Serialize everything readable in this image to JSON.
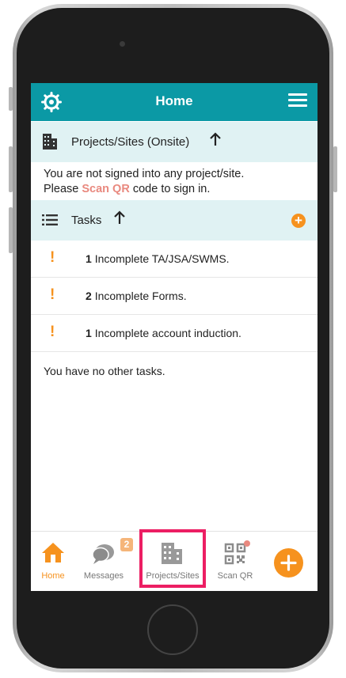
{
  "header": {
    "title": "Home"
  },
  "projects_section": {
    "title": "Projects/Sites (Onsite)",
    "message_part1": "You are not signed into any project/site.",
    "message_part2": "Please",
    "scan_link": "Scan QR",
    "message_part3": "code to sign in."
  },
  "tasks_section": {
    "title": "Tasks",
    "items": [
      {
        "count": "1",
        "text": "Incomplete TA/JSA/SWMS."
      },
      {
        "count": "2",
        "text": "Incomplete Forms."
      },
      {
        "count": "1",
        "text": "Incomplete account induction."
      }
    ],
    "footer": "You have no other tasks."
  },
  "tabbar": {
    "home": "Home",
    "messages": "Messages",
    "messages_badge": "2",
    "projects": "Projects/Sites",
    "scan": "Scan QR"
  },
  "colors": {
    "header": "#0b99a5",
    "accent": "#f6921e",
    "section_bg": "#e0f2f3",
    "highlight": "#ec1e63"
  }
}
